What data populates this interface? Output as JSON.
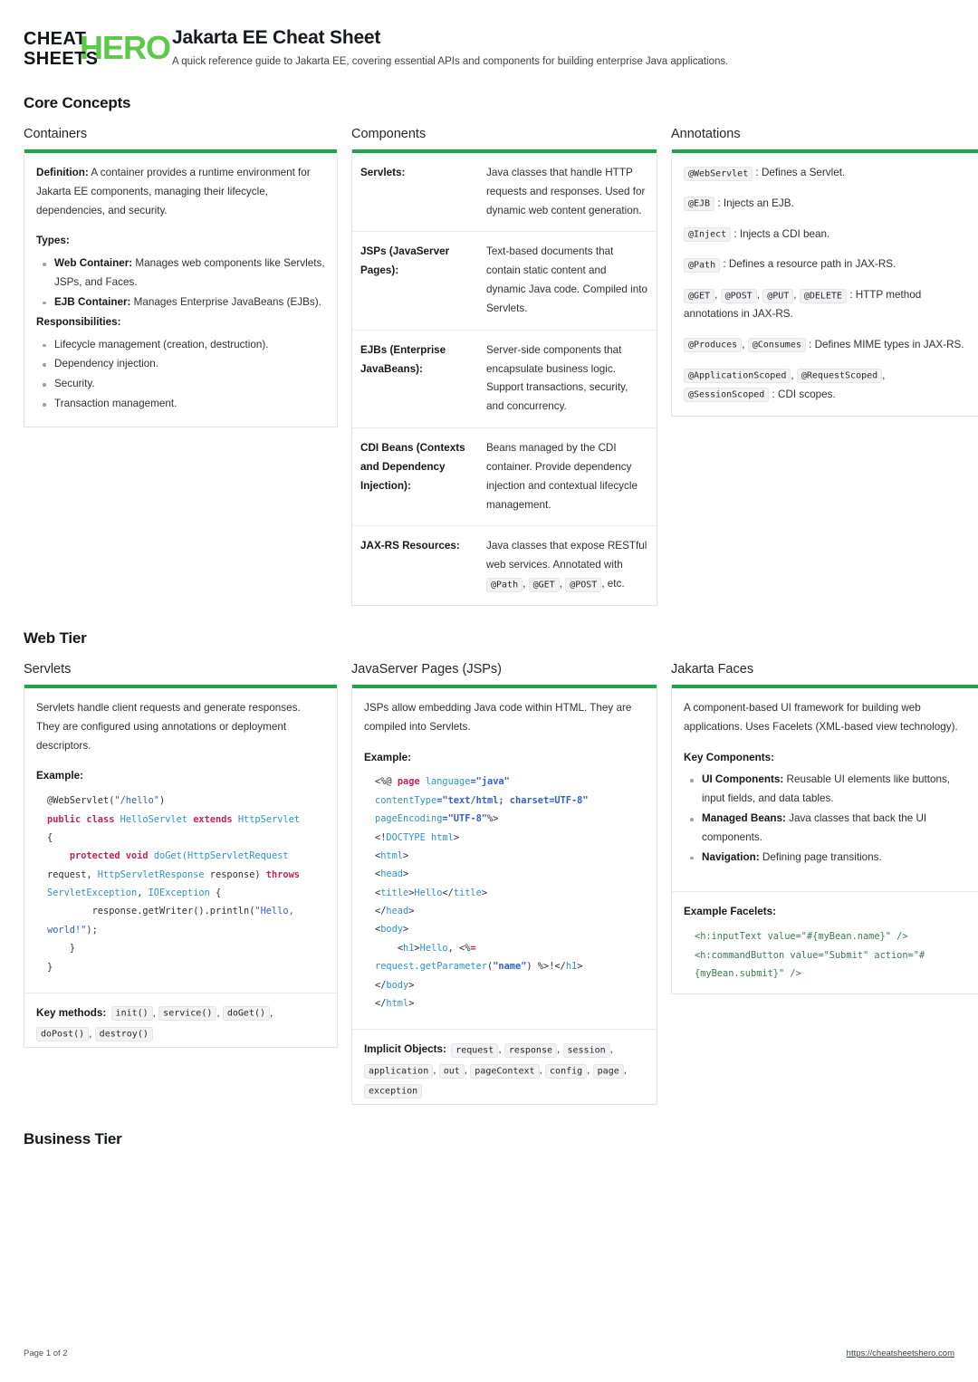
{
  "brand": {
    "logo_line1": "CHEAT",
    "logo_line2": "SHEETS",
    "logo_accent": "HERO",
    "accent_color": "#5cc94a"
  },
  "header": {
    "title": "Jakarta EE Cheat Sheet",
    "subtitle": "A quick reference guide to Jakarta EE, covering essential APIs and components for building enterprise Java applications."
  },
  "theme": {
    "card_accent": "#1fa34a",
    "card_border": "#e2e4e8",
    "chip_bg": "#f2f2f3"
  },
  "sections": {
    "core_concepts": "Core Concepts",
    "web_tier": "Web Tier",
    "business_tier": "Business Tier"
  },
  "containers": {
    "card_title": "Containers",
    "definition_label": "Definition:",
    "definition_text": " A container provides a runtime environment for Jakarta EE components, managing their lifecycle, dependencies, and security.",
    "types_label": "Types:",
    "types": [
      {
        "label": "Web Container:",
        "text": " Manages web components like Servlets, JSPs, and Faces."
      },
      {
        "label": "EJB Container:",
        "text": " Manages Enterprise JavaBeans (EJBs)."
      }
    ],
    "responsibilities_label": "Responsibilities:",
    "responsibilities": [
      "Lifecycle management (creation, destruction).",
      "Dependency injection.",
      "Security.",
      "Transaction management."
    ]
  },
  "components": {
    "card_title": "Components",
    "rows": [
      {
        "name": "Servlets:",
        "desc": "Java classes that handle HTTP requests and responses. Used for dynamic web content generation."
      },
      {
        "name": "JSPs (JavaServer Pages):",
        "desc": "Text-based documents that contain static content and dynamic Java code. Compiled into Servlets."
      },
      {
        "name": "EJBs (Enterprise JavaBeans):",
        "desc": "Server-side components that encapsulate business logic. Support transactions, security, and concurrency."
      },
      {
        "name": "CDI Beans (Contexts and Dependency Injection):",
        "desc": "Beans managed by the CDI container. Provide dependency injection and contextual lifecycle management."
      },
      {
        "name": "JAX-RS Resources:",
        "desc_prefix": "Java classes that expose RESTful web services. Annotated with ",
        "chips": [
          "@Path",
          "@GET",
          "@POST"
        ],
        "desc_suffix": ", etc."
      }
    ]
  },
  "annotations": {
    "card_title": "Annotations",
    "items": [
      {
        "chips": [
          "@WebServlet"
        ],
        "text": ": Defines a Servlet."
      },
      {
        "chips": [
          "@EJB"
        ],
        "text": ": Injects an EJB."
      },
      {
        "chips": [
          "@Inject"
        ],
        "text": ": Injects a CDI bean."
      },
      {
        "chips": [
          "@Path"
        ],
        "text": ": Defines a resource path in JAX-RS."
      },
      {
        "chips": [
          "@GET",
          "@POST",
          "@PUT",
          "@DELETE"
        ],
        "text": ": HTTP method annotations in JAX-RS."
      },
      {
        "chips": [
          "@Produces",
          "@Consumes"
        ],
        "text": ": Defines MIME types in JAX-RS."
      },
      {
        "chips": [
          "@ApplicationScoped",
          "@RequestScoped",
          "@SessionScoped"
        ],
        "text": ": CDI scopes."
      }
    ]
  },
  "servlets": {
    "card_title": "Servlets",
    "intro": "Servlets handle client requests and generate responses. They are configured using annotations or deployment descriptors.",
    "example_label": "Example:",
    "code": "@WebServlet(\"/hello\")\npublic class HelloServlet extends HttpServlet {\n    protected void doGet(HttpServletRequest request, HttpServletResponse response) throws ServletException, IOException {\n        response.getWriter().println(\"Hello, world!\");\n    }\n}",
    "key_methods_label": "Key methods:",
    "key_methods": [
      "init()",
      "service()",
      "doGet()",
      "doPost()",
      "destroy()"
    ]
  },
  "jsp": {
    "card_title": "JavaServer Pages (JSPs)",
    "intro": "JSPs allow embedding Java code within HTML. They are compiled into Servlets.",
    "example_label": "Example:",
    "code": "<%@ page language=\"java\" contentType=\"text/html; charset=UTF-8\" pageEncoding=\"UTF-8\"%>\n<!DOCTYPE html>\n<html>\n<head>\n<title>Hello</title>\n</head>\n<body>\n    <h1>Hello, <%= request.getParameter(\"name\") %>!</h1>\n</body>\n</html>",
    "implicit_label": "Implicit Objects:",
    "implicit_objects": [
      "request",
      "response",
      "session",
      "application",
      "out",
      "pageContext",
      "config",
      "page",
      "exception"
    ]
  },
  "faces": {
    "card_title": "Jakarta Faces",
    "intro": "A component-based UI framework for building web applications. Uses Facelets (XML-based view technology).",
    "key_components_label": "Key Components:",
    "key_components": [
      {
        "label": "UI Components:",
        "text": " Reusable UI elements like buttons, input fields, and data tables."
      },
      {
        "label": "Managed Beans:",
        "text": " Java classes that back the UI components."
      },
      {
        "label": "Navigation:",
        "text": " Defining page transitions."
      }
    ],
    "example_label": "Example Facelets:",
    "code": "<h:inputText value=\"#{myBean.name}\" />\n<h:commandButton value=\"Submit\" action=\"#{myBean.submit}\" />"
  },
  "footer": {
    "page_label": "Page 1 of 2",
    "site_url": "https://cheatsheetshero.com"
  }
}
